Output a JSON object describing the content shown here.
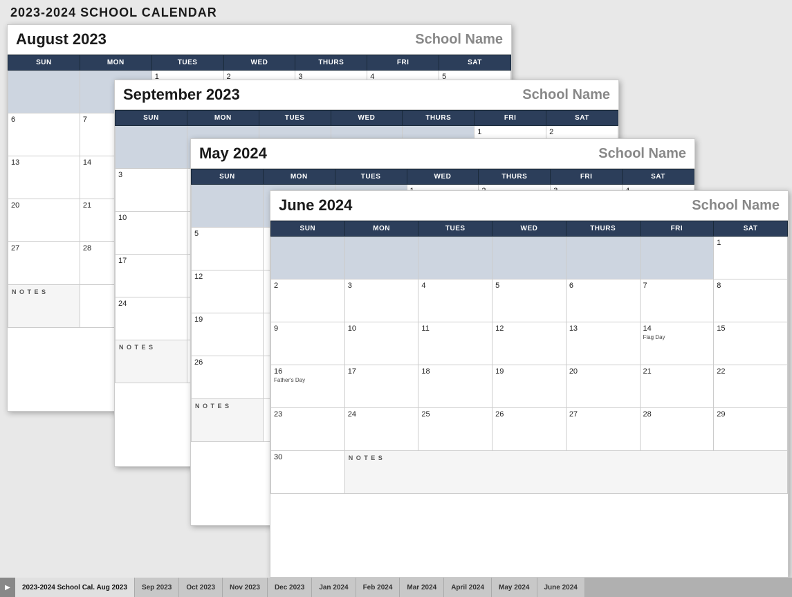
{
  "title": "2023-2024 SCHOOL CALENDAR",
  "schoolName": "School Name",
  "calendars": {
    "august": {
      "monthYear": "August 2023",
      "headers": [
        "SUN",
        "MON",
        "TUES",
        "WED",
        "THURS",
        "FRI",
        "SAT"
      ]
    },
    "september": {
      "monthYear": "September 2023",
      "headers": [
        "SUN",
        "MON",
        "TUES",
        "WED",
        "THURS",
        "FRI",
        "SAT"
      ]
    },
    "may": {
      "monthYear": "May 2024",
      "headers": [
        "SUN",
        "MON",
        "TUES",
        "WED",
        "THURS",
        "FRI",
        "SAT"
      ]
    },
    "june": {
      "monthYear": "June 2024",
      "headers": [
        "SUN",
        "MON",
        "TUES",
        "WED",
        "THURS",
        "FRI",
        "SAT"
      ],
      "weeks": [
        [
          {
            "day": "",
            "shaded": true
          },
          {
            "day": "",
            "shaded": true
          },
          {
            "day": "",
            "shaded": true
          },
          {
            "day": "",
            "shaded": true
          },
          {
            "day": "",
            "shaded": true
          },
          {
            "day": "",
            "shaded": true
          },
          {
            "day": "1",
            "shaded": false
          }
        ],
        [
          {
            "day": "2"
          },
          {
            "day": "3"
          },
          {
            "day": "4"
          },
          {
            "day": "5"
          },
          {
            "day": "6"
          },
          {
            "day": "7"
          },
          {
            "day": "8"
          }
        ],
        [
          {
            "day": "9"
          },
          {
            "day": "10"
          },
          {
            "day": "11"
          },
          {
            "day": "12"
          },
          {
            "day": "13"
          },
          {
            "day": "14"
          },
          {
            "day": "15",
            "event": "Flag Day"
          }
        ],
        [
          {
            "day": "16"
          },
          {
            "day": "17"
          },
          {
            "day": "18"
          },
          {
            "day": "19"
          },
          {
            "day": "20"
          },
          {
            "day": "21"
          },
          {
            "day": "22"
          }
        ],
        [
          {
            "day": "23"
          },
          {
            "day": "24"
          },
          {
            "day": "25"
          },
          {
            "day": "26"
          },
          {
            "day": "27"
          },
          {
            "day": "28"
          },
          {
            "day": "29"
          }
        ],
        [
          {
            "day": "30",
            "notes": false
          },
          {
            "day": "NOTES",
            "colspan": 6,
            "notes": true
          }
        ]
      ],
      "events": {
        "14": "Flag Day",
        "16": "Father's Day"
      }
    }
  },
  "tabs": [
    {
      "label": "2023-2024 School Cal. Aug 2023",
      "active": true
    },
    {
      "label": "Sep 2023"
    },
    {
      "label": "Oct 2023"
    },
    {
      "label": "Nov 2023"
    },
    {
      "label": "Dec 2023"
    },
    {
      "label": "Jan 2024"
    },
    {
      "label": "Feb 2024"
    },
    {
      "label": "Mar 2024"
    },
    {
      "label": "April 2024"
    },
    {
      "label": "May 2024"
    },
    {
      "label": "June 2024"
    }
  ],
  "colors": {
    "headerBg": "#2c3e5a",
    "shadedCell": "#cdd5e0"
  }
}
